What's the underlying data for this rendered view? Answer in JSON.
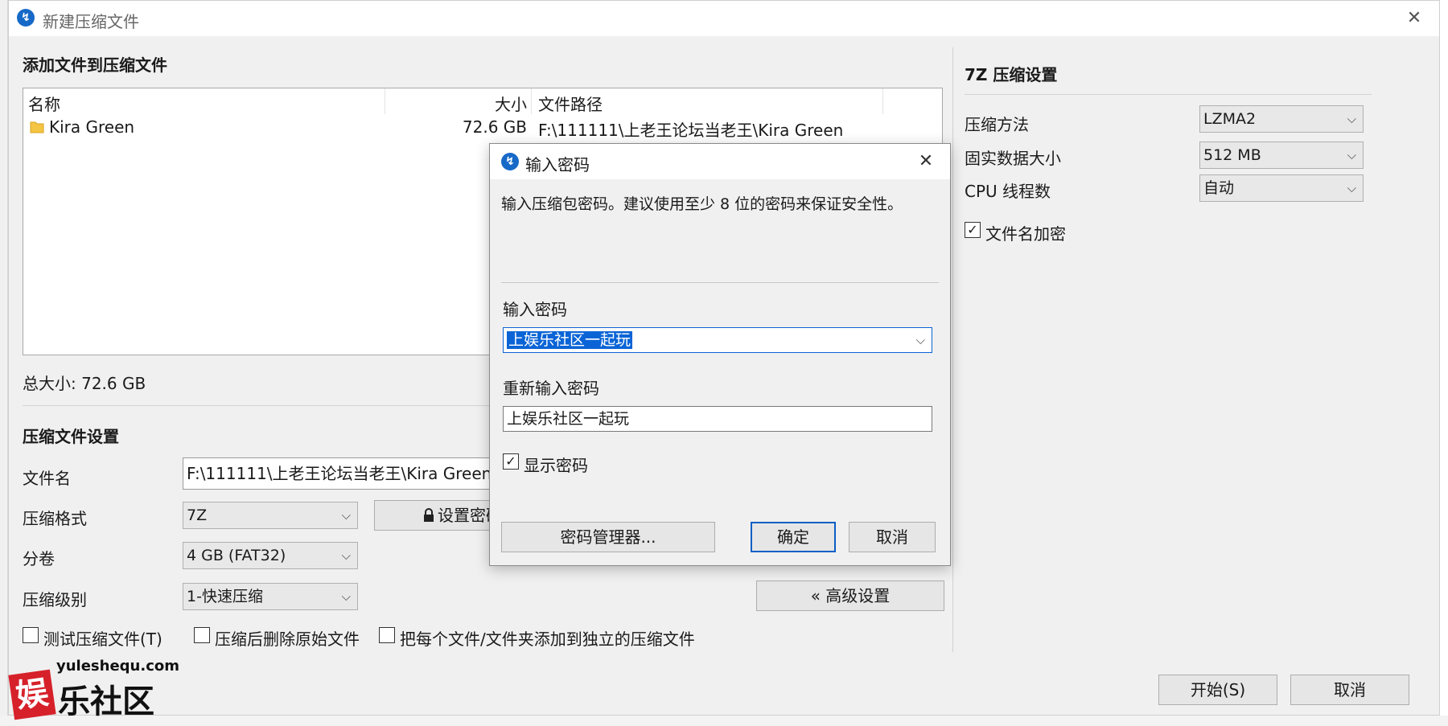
{
  "window": {
    "title": "新建压缩文件",
    "close_glyph": "✕",
    "app_icon_glyph": "↯"
  },
  "left": {
    "section_add": "添加文件到压缩文件",
    "list": {
      "col_name": "名称",
      "col_size": "大小",
      "col_path": "文件路径",
      "rows": [
        {
          "name": "Kira Green",
          "size": "72.6 GB",
          "path": "F:\\111111\\上老王论坛当老王\\Kira Green"
        }
      ]
    },
    "total_size": "总大小: 72.6 GB",
    "section_settings": "压缩文件设置",
    "filename_label": "文件名",
    "filename_value": "F:\\111111\\上老王论坛当老王\\Kira Green.7z",
    "format_label": "压缩格式",
    "format_value": "7Z",
    "set_password_label": "设置密码",
    "split_label": "分卷",
    "split_value": "4 GB (FAT32)",
    "level_label": "压缩级别",
    "level_value": "1-快速压缩",
    "advanced_label": "« 高级设置",
    "check_test": "测试压缩文件(T)",
    "check_delete": "压缩后删除原始文件",
    "check_separate": "把每个文件/文件夹添加到独立的压缩文件"
  },
  "right": {
    "title": "7Z 压缩设置",
    "method_label": "压缩方法",
    "method_value": "LZMA2",
    "solid_label": "固实数据大小",
    "solid_value": "512 MB",
    "threads_label": "CPU 线程数",
    "threads_value": "自动",
    "encrypt_names_label": "文件名加密",
    "encrypt_names_checked": true
  },
  "footer": {
    "start_label": "开始(S)",
    "cancel_label": "取消"
  },
  "dialog": {
    "title": "输入密码",
    "description": "输入压缩包密码。建议使用至少 8 位的密码来保证安全性。",
    "password_label": "输入密码",
    "password_value": "上娱乐社区一起玩",
    "confirm_label": "重新输入密码",
    "confirm_value": "上娱乐社区一起玩",
    "show_password_label": "显示密码",
    "show_password_checked": true,
    "manager_label": "密码管理器...",
    "ok_label": "确定",
    "cancel_label": "取消"
  },
  "watermark": {
    "domain": "yuleshequ.com",
    "brand_char": "娱",
    "brand_text": "乐社区"
  },
  "colors": {
    "accent": "#0a64d6",
    "window_bg": "#f0f0f0",
    "watermark_red": "#d6212a"
  }
}
